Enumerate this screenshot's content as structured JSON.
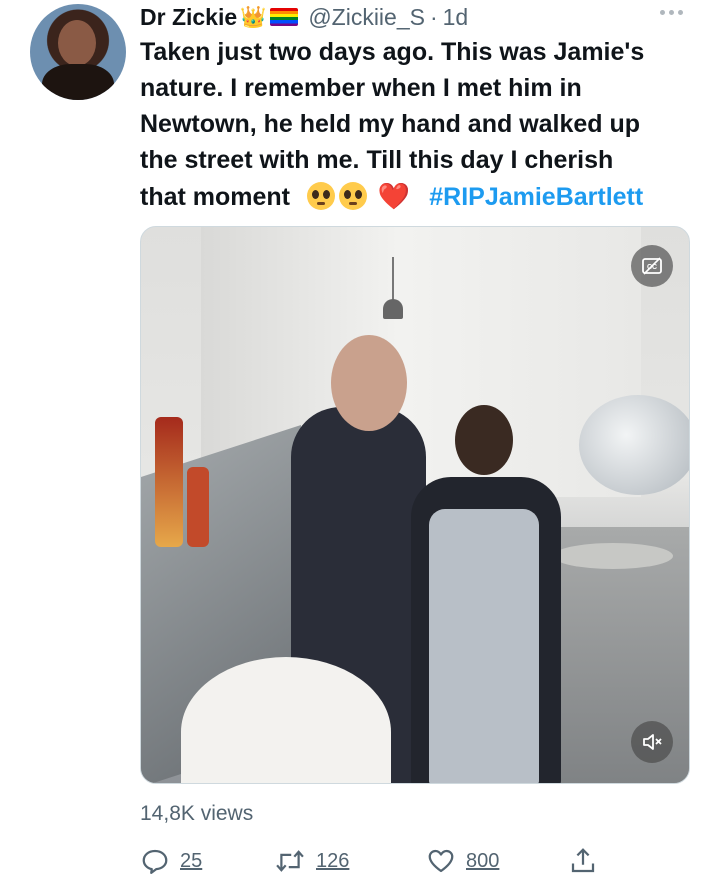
{
  "author": {
    "display_name": "Dr Zickie",
    "crown_emoji": "👑",
    "handle": "@Zickiie_S",
    "separator": "·",
    "time": "1d"
  },
  "tweet": {
    "lines": [
      "Taken just two days ago. This was Jamie's",
      "nature. I remember when I met him in",
      "Newtown, he held my hand and walked up",
      "the street with me. Till this day I cherish",
      "that moment"
    ],
    "heart_emoji": "❤️",
    "hashtag": "#RIPJamieBartlett"
  },
  "media": {
    "cc_icon": "closed-captions-off-icon",
    "mute_icon": "volume-muted-icon"
  },
  "stats": {
    "views": "14,8K views"
  },
  "actions": {
    "replies": "25",
    "retweets": "126",
    "likes": "800"
  },
  "colors": {
    "hashtag": "#1d9bf0",
    "secondary_text": "#536471",
    "primary_text": "#0f1419"
  }
}
